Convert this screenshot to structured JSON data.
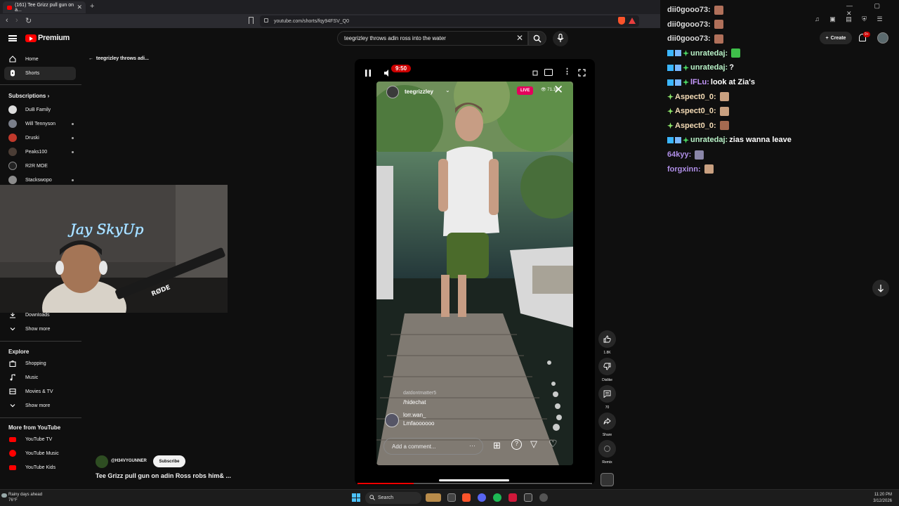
{
  "browser": {
    "tab_title": "(161) Tee Grizz pull gun on a...",
    "new_tab": "+",
    "url": "youtube.com/shorts/fqy94FSV_Q0",
    "window_controls": "— ▢ ✕"
  },
  "youtube": {
    "brand": "Premium",
    "search_query": "teegrizley throws adin ross into the water",
    "create_label": "Create",
    "notif_count": "9+"
  },
  "sidebar": {
    "home": "Home",
    "shorts": "Shorts",
    "subscriptions_header": "Subscriptions",
    "channels": [
      "DuB Family",
      "Will Tennyson",
      "Druski",
      "Peaks100",
      "R2R MOE",
      "Stackswopo"
    ],
    "downloads": "Downloads",
    "show_more": "Show more",
    "explore_header": "Explore",
    "explore": [
      "Shopping",
      "Music",
      "Movies & TV"
    ],
    "explore_show_more": "Show more",
    "more_header": "More from YouTube",
    "more": [
      "YouTube TV",
      "YouTube Music",
      "YouTube Kids"
    ]
  },
  "back_title": "teegrizley throws adi...",
  "video": {
    "time_badge": "9:50",
    "live": "LIVE",
    "viewers": "71.1K",
    "ig_username": "teegrizzley",
    "comments": [
      {
        "user": "datdontmatter5",
        "text": "/hidechat"
      },
      {
        "user": "lorr.wan_",
        "text": "Lmfaoooooo"
      }
    ],
    "comment_placeholder": "Add a comment...",
    "progress": 0.24
  },
  "actions": {
    "like_count": "1.8K",
    "dislike": "Dislike",
    "comments": "70",
    "share": "Share",
    "remix": "Remix"
  },
  "channel": {
    "name": "@H34VYGUNNER",
    "subscribe": "Subscribe",
    "title": "Tee Grizz pull gun on adin Ross robs him& ..."
  },
  "chat": [
    {
      "user": "dii0gooo73:",
      "msg": "",
      "style": "white",
      "badges": 0,
      "emote": "#b0705a"
    },
    {
      "user": "dii0gooo73:",
      "msg": "",
      "style": "white",
      "badges": 0,
      "emote": "#b0705a"
    },
    {
      "user": "dii0gooo73:",
      "msg": "",
      "style": "white",
      "badges": 0,
      "emote": "#b0705a"
    },
    {
      "user": "unratedaj:",
      "msg": "",
      "style": "mint",
      "badges": 3,
      "emote": "#3fbf4a"
    },
    {
      "user": "unratedaj:",
      "msg": "?",
      "style": "mint",
      "badges": 3,
      "emote": ""
    },
    {
      "user": "lFLu:",
      "msg": "look at Zia's",
      "style": "purple",
      "badges": 3,
      "emote": ""
    },
    {
      "user": "Aspect0_0:",
      "msg": "",
      "style": "peach",
      "badges": 1,
      "emote": "#c9a080"
    },
    {
      "user": "Aspect0_0:",
      "msg": "",
      "style": "peach",
      "badges": 1,
      "emote": "#c9a080"
    },
    {
      "user": "Aspect0_0:",
      "msg": "",
      "style": "peach",
      "badges": 1,
      "emote": "#a56a50"
    },
    {
      "user": "unratedaj:",
      "msg": "zias wanna leave",
      "style": "mint",
      "badges": 3,
      "emote": ""
    },
    {
      "user": "64kyy:",
      "msg": "",
      "style": "lilac",
      "badges": 0,
      "emote": "#8a86a8"
    },
    {
      "user": "forgxinn:",
      "msg": "",
      "style": "lilac",
      "badges": 0,
      "emote": "#c9a080"
    }
  ],
  "taskbar": {
    "weather_line1": "Rainy days ahead",
    "weather_line2": "76°F",
    "search": "Search",
    "time": "11:20 PM",
    "date": "3/12/2026"
  },
  "colors": {
    "accent_red": "#ff0000",
    "live_pink": "#e5005c",
    "bg": "#0f0f0f"
  }
}
